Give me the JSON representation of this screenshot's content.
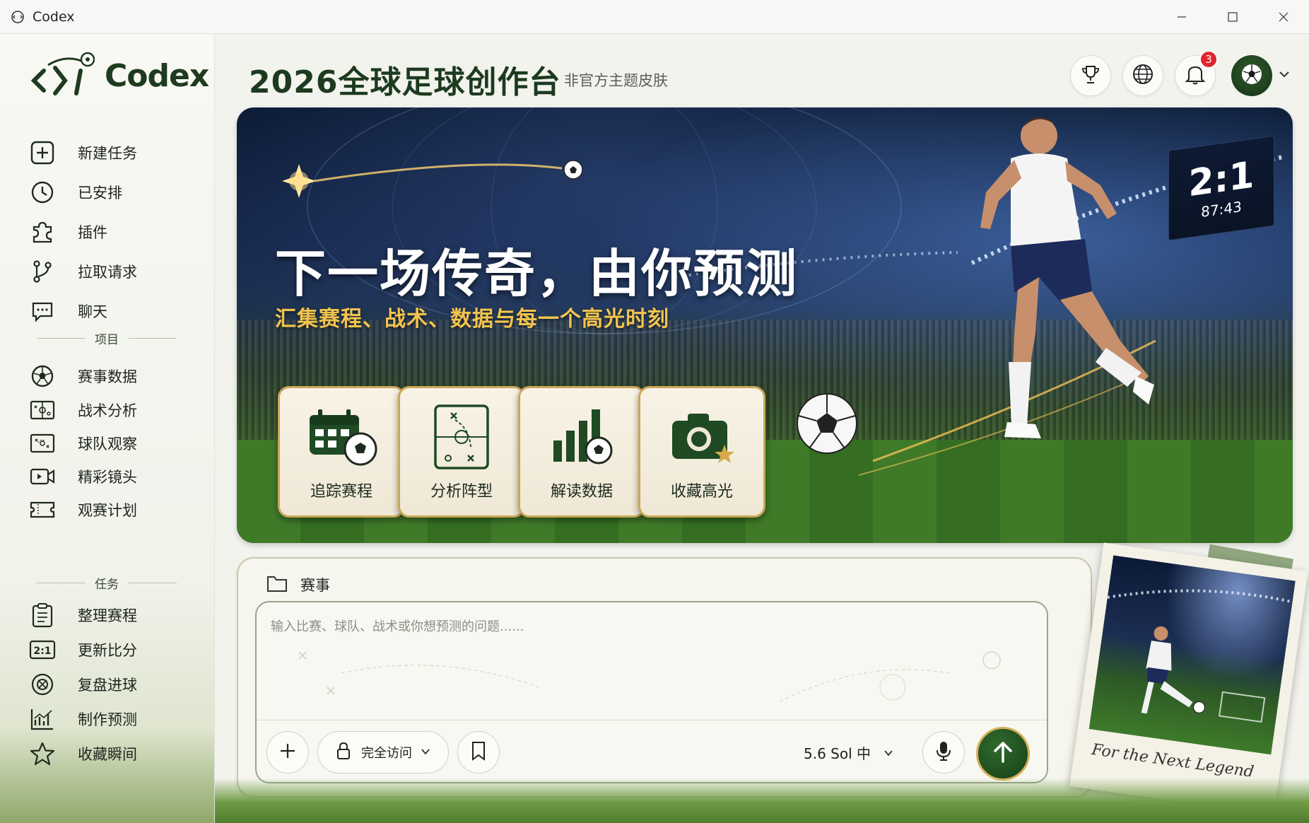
{
  "window": {
    "title": "Codex"
  },
  "sidebar": {
    "logo_text": "Codex",
    "nav": [
      {
        "label": "新建任务",
        "icon": "plus-square-icon"
      },
      {
        "label": "已安排",
        "icon": "clock-icon"
      },
      {
        "label": "插件",
        "icon": "puzzle-icon"
      },
      {
        "label": "拉取请求",
        "icon": "git-branch-icon"
      },
      {
        "label": "聊天",
        "icon": "chat-icon"
      }
    ],
    "projects_heading": "项目",
    "projects": [
      {
        "label": "赛事数据",
        "icon": "soccer-ball-icon"
      },
      {
        "label": "战术分析",
        "icon": "tactics-board-icon"
      },
      {
        "label": "球队观察",
        "icon": "formation-icon"
      },
      {
        "label": "精彩镜头",
        "icon": "video-icon"
      },
      {
        "label": "观赛计划",
        "icon": "ticket-icon"
      }
    ],
    "tasks_heading": "任务",
    "tasks": [
      {
        "label": "整理赛程",
        "icon": "clipboard-icon"
      },
      {
        "label": "更新比分",
        "icon": "score-icon"
      },
      {
        "label": "复盘进球",
        "icon": "target-icon"
      },
      {
        "label": "制作预测",
        "icon": "chart-icon"
      },
      {
        "label": "收藏瞬间",
        "icon": "star-icon"
      }
    ]
  },
  "header": {
    "title": "2026全球足球创作台",
    "subtitle": "非官方主题皮肤",
    "notification_count": "3"
  },
  "hero": {
    "title": "下一场传奇，由你预测",
    "subtitle": "汇集赛程、战术、数据与每一个高光时刻",
    "score": "2:1",
    "clock": "87:43",
    "cards": [
      {
        "label": "追踪赛程",
        "icon": "calendar-ball-icon"
      },
      {
        "label": "分析阵型",
        "icon": "tactics-board-icon"
      },
      {
        "label": "解读数据",
        "icon": "bar-chart-ball-icon"
      },
      {
        "label": "收藏高光",
        "icon": "camera-star-icon"
      }
    ]
  },
  "composer": {
    "folder_label": "赛事",
    "placeholder": "输入比赛、球队、战术或你想预测的问题......",
    "access_label": "完全访问",
    "model_label": "5.6 Sol 中"
  },
  "polaroid": {
    "caption": "For the Next Legend"
  },
  "colors": {
    "accent": "#1d3a1f",
    "gold": "#f2c44d",
    "badge": "#e0262b"
  }
}
